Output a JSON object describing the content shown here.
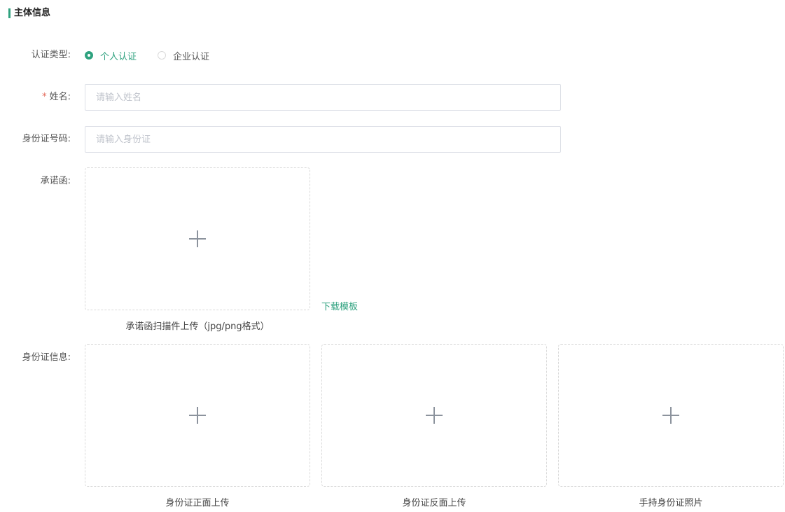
{
  "section": {
    "title": "主体信息",
    "accent_color": "#2fa27f"
  },
  "auth_type": {
    "label": "认证类型:",
    "options": [
      {
        "label": "个人认证",
        "checked": true
      },
      {
        "label": "企业认证",
        "checked": false
      }
    ]
  },
  "name_field": {
    "required_mark": "*",
    "label": "姓名:",
    "placeholder": "请输入姓名",
    "value": ""
  },
  "id_field": {
    "label": "身份证号码:",
    "placeholder": "请输入身份证",
    "value": ""
  },
  "commitment": {
    "label": "承诺函:",
    "caption": "承诺函扫描件上传（jpg/png格式）",
    "download_link": "下载模板",
    "upload_icon": "plus-icon"
  },
  "id_info": {
    "label": "身份证信息:",
    "uploads": [
      {
        "caption": "身份证正面上传",
        "icon": "plus-icon"
      },
      {
        "caption": "身份证反面上传",
        "icon": "plus-icon"
      },
      {
        "caption": "手持身份证照片",
        "icon": "plus-icon"
      }
    ]
  }
}
